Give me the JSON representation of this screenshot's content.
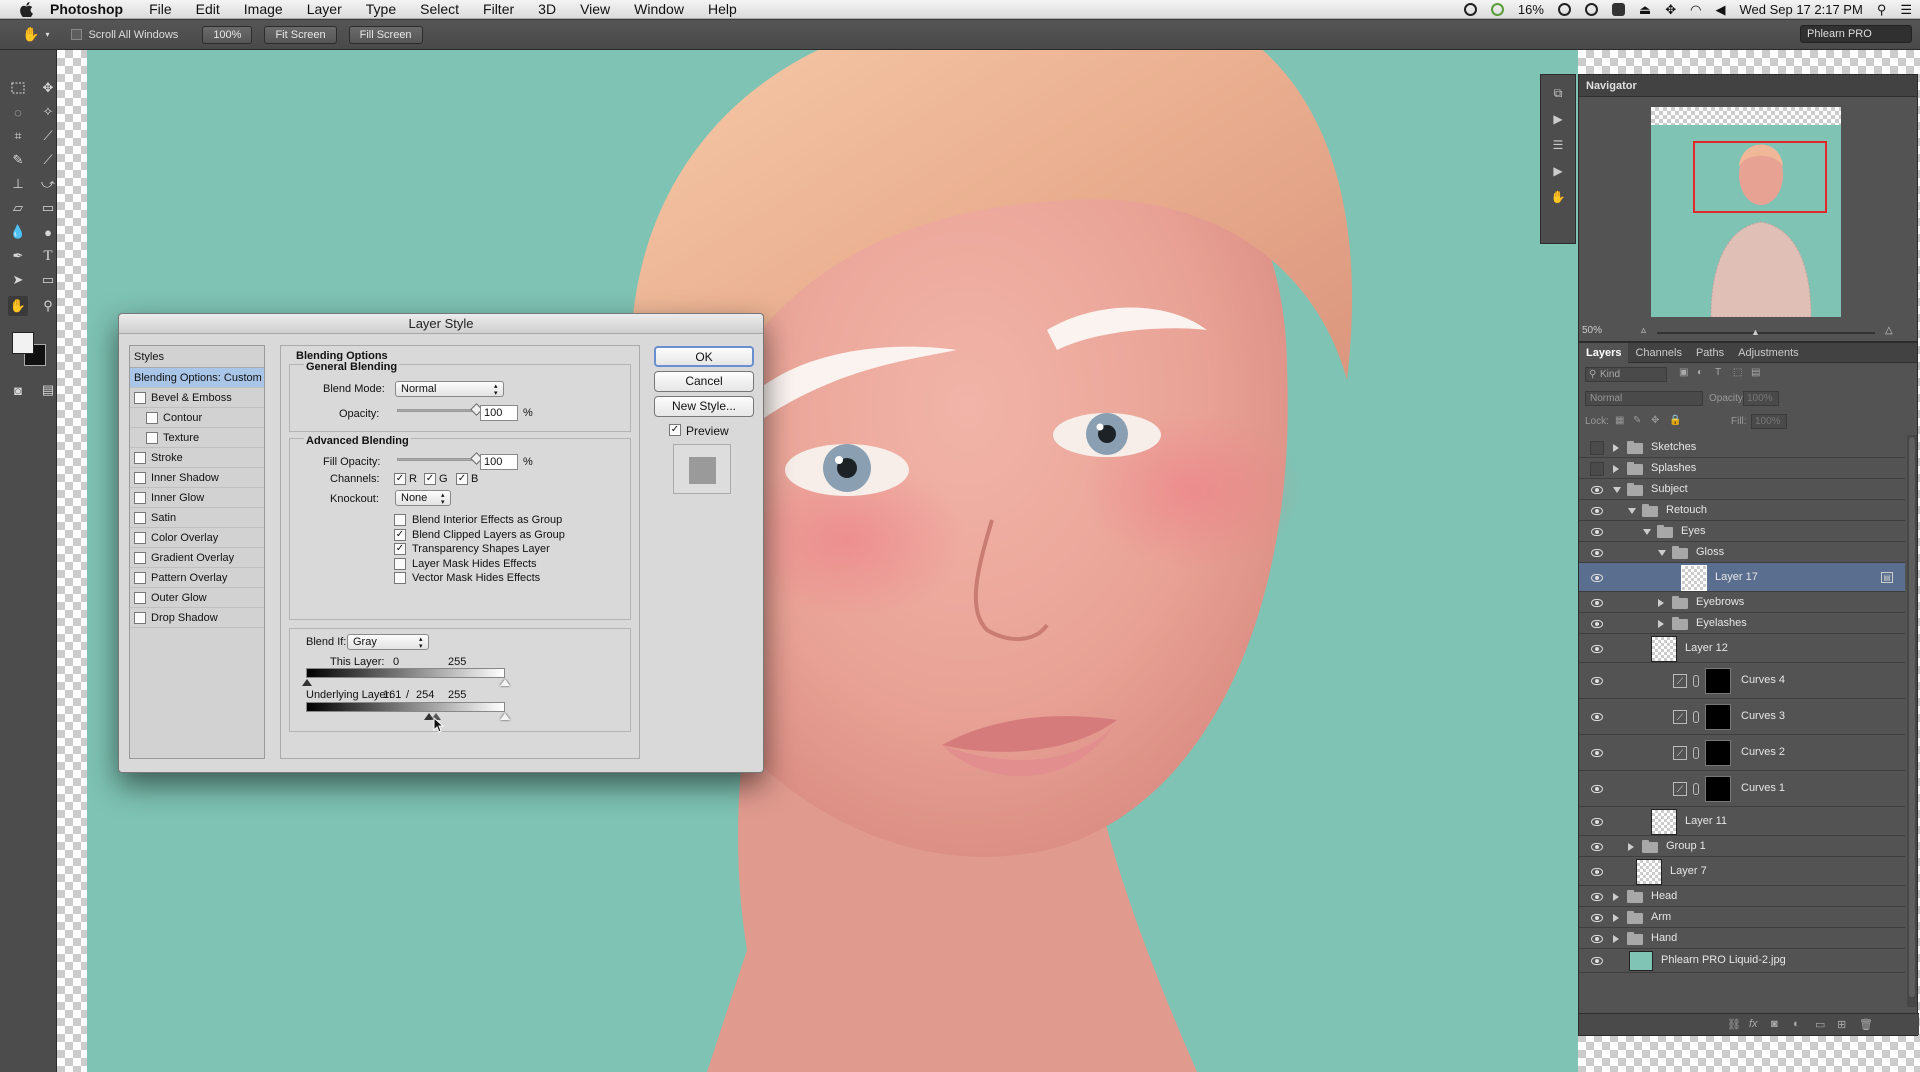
{
  "menubar": {
    "app_name": "Photoshop",
    "items": [
      "File",
      "Edit",
      "Image",
      "Layer",
      "Type",
      "Select",
      "Filter",
      "3D",
      "View",
      "Window",
      "Help"
    ],
    "battery": "16%",
    "clock": "Wed Sep 17  2:17 PM"
  },
  "options_bar": {
    "scroll_all_windows": "Scroll All Windows",
    "btn_100": "100%",
    "btn_fit": "Fit Screen",
    "btn_fill": "Fill Screen",
    "workspace": "Phlearn PRO"
  },
  "dialog": {
    "title": "Layer Style",
    "styles_header": "Styles",
    "styles": [
      {
        "label": "Blending Options: Custom",
        "checkbox": false,
        "selected": true,
        "sub": false
      },
      {
        "label": "Bevel & Emboss",
        "checkbox": true,
        "selected": false,
        "sub": false
      },
      {
        "label": "Contour",
        "checkbox": true,
        "selected": false,
        "sub": true
      },
      {
        "label": "Texture",
        "checkbox": true,
        "selected": false,
        "sub": true
      },
      {
        "label": "Stroke",
        "checkbox": true,
        "selected": false,
        "sub": false
      },
      {
        "label": "Inner Shadow",
        "checkbox": true,
        "selected": false,
        "sub": false
      },
      {
        "label": "Inner Glow",
        "checkbox": true,
        "selected": false,
        "sub": false
      },
      {
        "label": "Satin",
        "checkbox": true,
        "selected": false,
        "sub": false
      },
      {
        "label": "Color Overlay",
        "checkbox": true,
        "selected": false,
        "sub": false
      },
      {
        "label": "Gradient Overlay",
        "checkbox": true,
        "selected": false,
        "sub": false
      },
      {
        "label": "Pattern Overlay",
        "checkbox": true,
        "selected": false,
        "sub": false
      },
      {
        "label": "Outer Glow",
        "checkbox": true,
        "selected": false,
        "sub": false
      },
      {
        "label": "Drop Shadow",
        "checkbox": true,
        "selected": false,
        "sub": false
      }
    ],
    "blending_options": "Blending Options",
    "general_blending": "General Blending",
    "blend_mode_label": "Blend Mode:",
    "blend_mode": "Normal",
    "opacity_label": "Opacity:",
    "opacity": "100",
    "percent": "%",
    "advanced_blending": "Advanced Blending",
    "fill_opacity_label": "Fill Opacity:",
    "fill_opacity": "100",
    "channels_label": "Channels:",
    "channels": [
      "R",
      "G",
      "B"
    ],
    "knockout_label": "Knockout:",
    "knockout": "None",
    "checks": [
      {
        "label": "Blend Interior Effects as Group",
        "checked": false
      },
      {
        "label": "Blend Clipped Layers as Group",
        "checked": true
      },
      {
        "label": "Transparency Shapes Layer",
        "checked": true
      },
      {
        "label": "Layer Mask Hides Effects",
        "checked": false
      },
      {
        "label": "Vector Mask Hides Effects",
        "checked": false
      }
    ],
    "blend_if_label": "Blend If:",
    "blend_if": "Gray",
    "this_layer_label": "This Layer:",
    "this_layer_low": "0",
    "this_layer_high": "255",
    "underlying_label": "Underlying Layer:",
    "underlying_low": "161",
    "underlying_sep": "/",
    "underlying_mid": "254",
    "underlying_high": "255",
    "ok": "OK",
    "cancel": "Cancel",
    "new_style": "New Style...",
    "preview": "Preview"
  },
  "navigator": {
    "title": "Navigator",
    "zoom": "50%"
  },
  "layers": {
    "tabs": [
      "Layers",
      "Channels",
      "Paths",
      "Adjustments"
    ],
    "kind": "Kind",
    "blend": "Normal",
    "opacity_label": "Opacity:",
    "opacity": "100%",
    "lock_label": "Lock:",
    "fill_label": "Fill:",
    "fill": "100%",
    "rows": [
      {
        "name": "Sketches",
        "type": "group",
        "depth": 0,
        "expanded": false,
        "visible": false
      },
      {
        "name": "Splashes",
        "type": "group",
        "depth": 0,
        "expanded": false,
        "visible": false
      },
      {
        "name": "Subject",
        "type": "group",
        "depth": 0,
        "expanded": true,
        "visible": true
      },
      {
        "name": "Retouch",
        "type": "group",
        "depth": 1,
        "expanded": true,
        "visible": true
      },
      {
        "name": "Eyes",
        "type": "group",
        "depth": 2,
        "expanded": true,
        "visible": true
      },
      {
        "name": "Gloss",
        "type": "group",
        "depth": 3,
        "expanded": true,
        "visible": true
      },
      {
        "name": "Layer 17",
        "type": "layer",
        "depth": 4,
        "visible": true,
        "selected": true
      },
      {
        "name": "Eyebrows",
        "type": "group",
        "depth": 3,
        "expanded": false,
        "visible": true
      },
      {
        "name": "Eyelashes",
        "type": "group",
        "depth": 3,
        "expanded": false,
        "visible": true
      },
      {
        "name": "Layer 12",
        "type": "layer",
        "depth": 2,
        "visible": true
      },
      {
        "name": "Curves 4",
        "type": "adjustment",
        "depth": 2,
        "visible": true
      },
      {
        "name": "Curves 3",
        "type": "adjustment",
        "depth": 2,
        "visible": true
      },
      {
        "name": "Curves 2",
        "type": "adjustment",
        "depth": 2,
        "visible": true
      },
      {
        "name": "Curves 1",
        "type": "adjustment",
        "depth": 2,
        "visible": true
      },
      {
        "name": "Layer 11",
        "type": "layer",
        "depth": 2,
        "visible": true
      },
      {
        "name": "Group 1",
        "type": "group",
        "depth": 1,
        "expanded": false,
        "visible": true
      },
      {
        "name": "Layer 7",
        "type": "layer",
        "depth": 1,
        "visible": true
      },
      {
        "name": "Head",
        "type": "group",
        "depth": 0,
        "expanded": false,
        "visible": true
      },
      {
        "name": "Arm",
        "type": "group",
        "depth": 0,
        "expanded": false,
        "visible": true
      },
      {
        "name": "Hand",
        "type": "group",
        "depth": 0,
        "expanded": false,
        "visible": true
      },
      {
        "name": "Phlearn PRO Liquid-2.jpg",
        "type": "image",
        "depth": 0,
        "visible": true
      }
    ]
  }
}
